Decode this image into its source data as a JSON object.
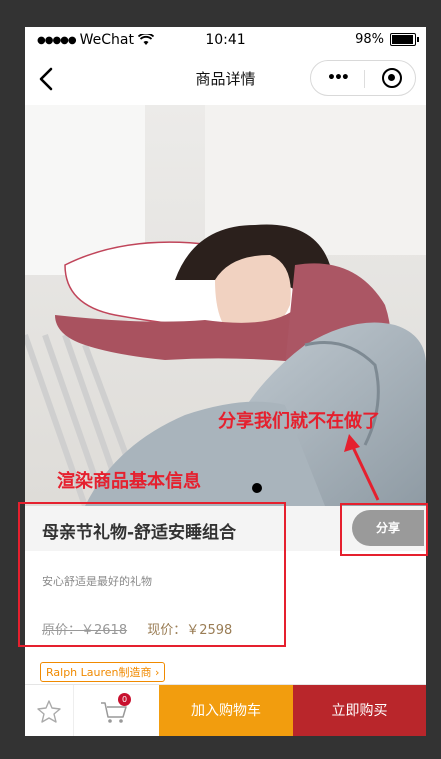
{
  "status": {
    "carrier": "WeChat",
    "time": "10:41",
    "battery": "98%",
    "battery_level": 0.98
  },
  "nav": {
    "title": "商品详情"
  },
  "product": {
    "title": "母亲节礼物-舒适安睡组合",
    "subtitle": "安心舒适是最好的礼物",
    "original_price_label": "原价：￥2618",
    "current_price_label": "现价：￥2598",
    "brand": "Ralph Lauren制造商"
  },
  "share": {
    "label": "分享"
  },
  "cart": {
    "badge": "0"
  },
  "actions": {
    "add_to_cart": "加入购物车",
    "buy_now": "立即购买"
  },
  "annotations": {
    "share_note": "分享我们就不在做了",
    "render_note": "渲染商品基本信息"
  },
  "colors": {
    "annotation": "#e5202e",
    "add_to_cart": "#f29d0e",
    "buy_now": "#b9262b",
    "share": "#9a9a9a"
  }
}
